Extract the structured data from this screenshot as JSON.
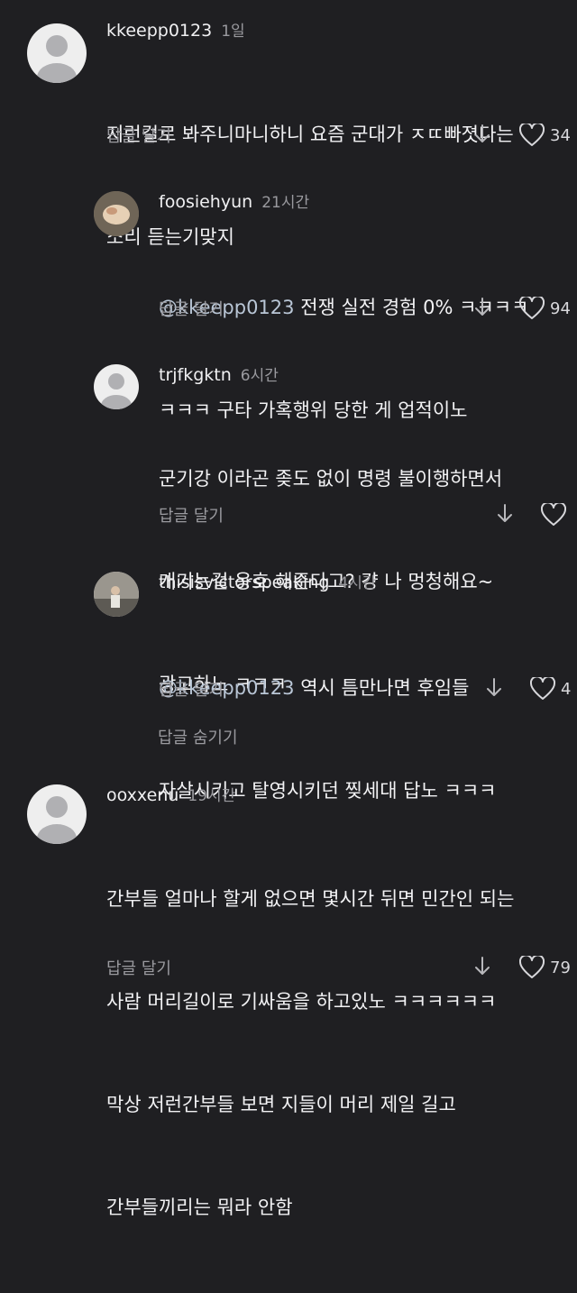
{
  "colors": {
    "background": "#1f1f22",
    "text": "#f2f2f4",
    "muted": "#9a9a9f",
    "mention": "#b9c6d6"
  },
  "reply_label": "답글 달기",
  "hide_replies_label": "답글 숨기기",
  "comments": [
    {
      "username": "kkeepp0123",
      "time": "1일",
      "line1": "저런걸로 봐주니마니하니 요즘 군대가 ㅈㄸ빠졋다는",
      "line2": "소리 듣는기맞지",
      "likes": "34",
      "avatar": "default-avatar-icon"
    },
    {
      "username": "foosiehyun",
      "time": "21시간",
      "mention": "@kkeepp0123",
      "line1": " 전쟁 실전 경험 0% ㅋㅋㅋㅋ",
      "line2": "ㅋㅋㅋ 구타 가혹행위 당한 게 업적이노",
      "likes": "94",
      "avatar": "photo-avatar"
    },
    {
      "username": "trjfkgktn",
      "time": "6시간",
      "line1": "군기강 이라곤 좆도 없이 명령 불이행하면서",
      "line2": "개기는걸 옹호 해준다고? 걍 나 멍청해요~",
      "line3": "광고하노 ㅋㅋㅋ",
      "likes": "",
      "avatar": "default-avatar-icon"
    },
    {
      "username": "thisisvictorspeaking",
      "time": "4시간",
      "mention": "@kkeepp0123",
      "line1": " 역시 틈만나면 후임들",
      "line2": "자살시키고 탈영시키던 찢세대 답노 ㅋㅋㅋ",
      "likes": "4",
      "avatar": "photo-avatar"
    },
    {
      "username": "ooxxenu",
      "time": "19시간",
      "line1": "간부들 얼마나 할게 없으면 몇시간 뒤면 민간인 되는",
      "line2": "사람 머리길이로 기싸움을 하고있노 ㅋㅋㅋㅋㅋㅋ",
      "line3": "막상 저런간부들 보면 지들이 머리 제일 길고",
      "line4": "간부들끼리는 뭐라 안함",
      "likes": "79",
      "avatar": "default-avatar-icon"
    }
  ]
}
